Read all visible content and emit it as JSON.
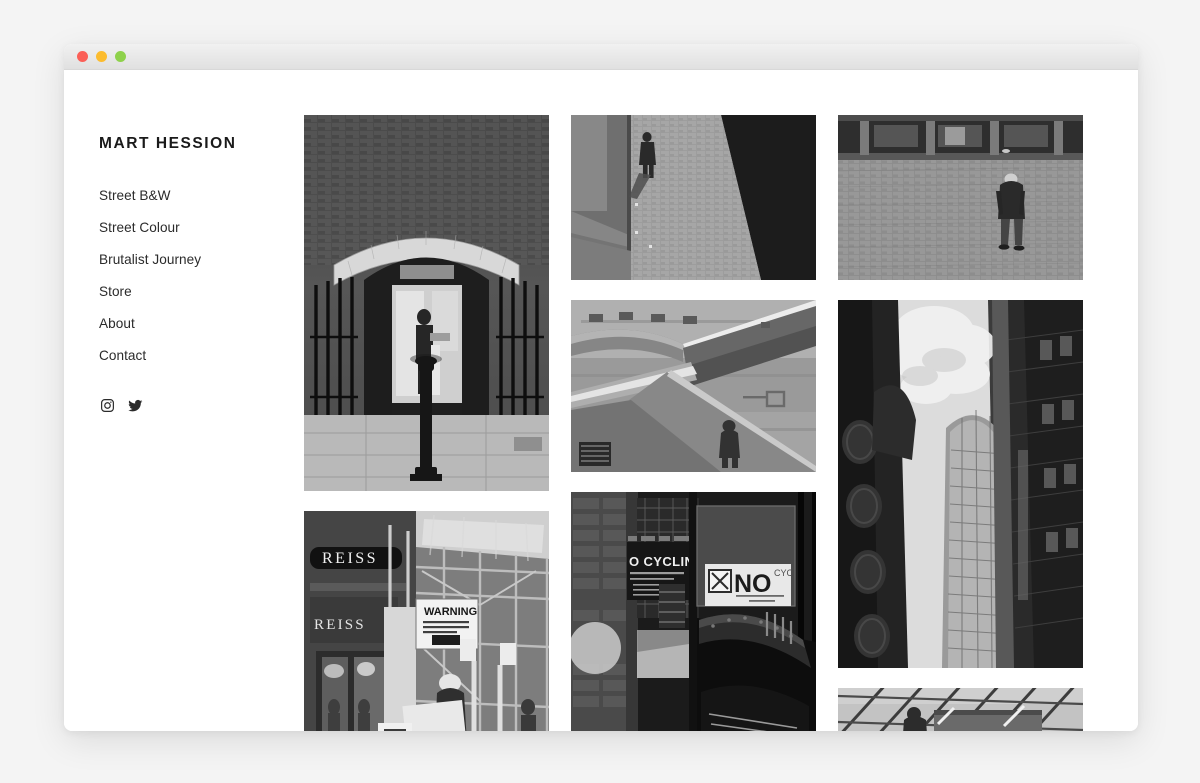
{
  "window": {
    "controls": [
      {
        "name": "close",
        "color": "#fb5f57"
      },
      {
        "name": "minimize",
        "color": "#fcbc2e"
      },
      {
        "name": "maximize",
        "color": "#8ed14b"
      }
    ]
  },
  "site": {
    "title": "MART HESSION",
    "nav": [
      {
        "label": "Street B&W"
      },
      {
        "label": "Street Colour"
      },
      {
        "label": "Brutalist Journey"
      },
      {
        "label": "Store"
      },
      {
        "label": "About"
      },
      {
        "label": "Contact"
      }
    ],
    "social": [
      {
        "label": "Instagram",
        "icon": "instagram-icon"
      },
      {
        "label": "Twitter",
        "icon": "twitter-icon"
      }
    ]
  },
  "gallery": {
    "columns": [
      {
        "id": "column-1",
        "photos": [
          {
            "id": "photo-brick-archway",
            "alt": "Brick archway entrance with iron railings and a bollard",
            "orientation": "portrait",
            "tone": "dark"
          },
          {
            "id": "photo-reiss-scaffolding",
            "alt": "REISS storefront behind scaffolding with a WARNING sign",
            "orientation": "square",
            "tone": "mid",
            "signs": [
              "REISS",
              "REISS",
              "WARNING"
            ]
          }
        ]
      },
      {
        "id": "column-2",
        "photos": [
          {
            "id": "photo-lone-walker-shadow",
            "alt": "Lone figure walking on a paved plaza cut by a hard diagonal shadow",
            "orientation": "landscape",
            "tone": "mid"
          },
          {
            "id": "photo-concrete-stairs",
            "alt": "Brutalist concrete staircase diagonals with a small figure",
            "orientation": "landscape",
            "tone": "light"
          },
          {
            "id": "photo-no-cycling-tunnel",
            "alt": "Tunnel entrance with NO CYCLING signage and riveted steelwork",
            "orientation": "square",
            "tone": "dark",
            "signs": [
              "NO CYCLING",
              "NO"
            ]
          }
        ]
      },
      {
        "id": "column-3",
        "photos": [
          {
            "id": "photo-man-on-cobbles",
            "alt": "Man walking away across a cobbled square seen from above",
            "orientation": "landscape",
            "tone": "mid"
          },
          {
            "id": "photo-alley-skyscraper",
            "alt": "Looking up a narrow alley at a curved glass tower and clouds",
            "orientation": "portrait",
            "tone": "dark"
          },
          {
            "id": "photo-glass-facade",
            "alt": "Glass facade lattice with diagonal struts",
            "orientation": "cropped",
            "tone": "light"
          }
        ]
      }
    ]
  }
}
